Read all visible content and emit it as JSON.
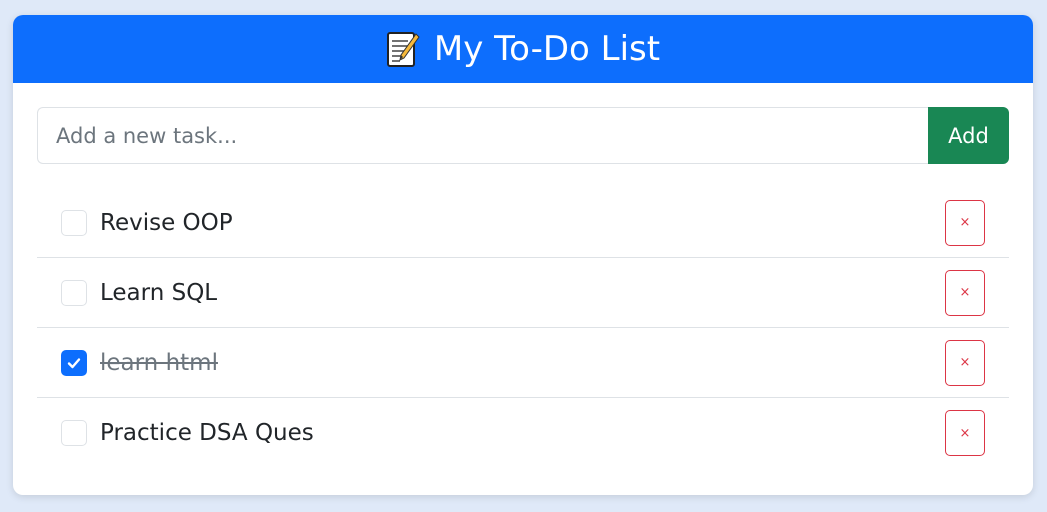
{
  "header": {
    "icon": "memo-icon",
    "title": "My To-Do List"
  },
  "input": {
    "placeholder": "Add a new task...",
    "value": "",
    "add_label": "Add"
  },
  "tasks": [
    {
      "label": "Revise OOP",
      "done": false,
      "delete_label": "×"
    },
    {
      "label": "Learn SQL",
      "done": false,
      "delete_label": "×"
    },
    {
      "label": "learn html",
      "done": true,
      "delete_label": "×"
    },
    {
      "label": "Practice DSA Ques",
      "done": false,
      "delete_label": "×"
    }
  ],
  "colors": {
    "header_bg": "#0d6efd",
    "add_button": "#198754",
    "delete_border": "#dc3545",
    "checked": "#0d6efd"
  }
}
